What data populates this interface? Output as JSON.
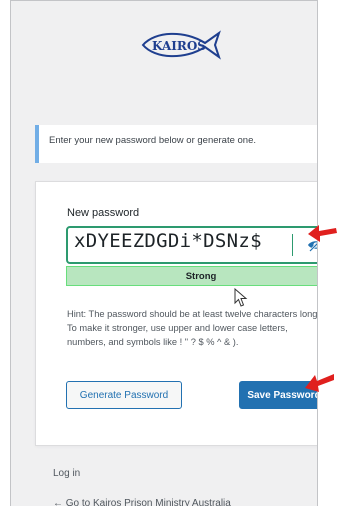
{
  "notice": {
    "text": "Enter your new password below or generate one."
  },
  "form": {
    "label": "New password",
    "password_value": "xDYEEZDGDi*DSNz$",
    "strength": "Strong",
    "hint": "Hint: The password should be at least twelve characters long. To make it stronger, use upper and lower case letters, numbers, and symbols like ! \" ? $ % ^ & ).",
    "generate_label": "Generate Password",
    "save_label": "Save Password"
  },
  "links": {
    "login": "Log in",
    "back": "← Go to Kairos Prison Ministry Australia"
  },
  "logo": {
    "text": "KAIROS"
  },
  "colors": {
    "accent": "#2271b1",
    "strong_bg": "#b8e6bf",
    "focus_border": "#2d9a6f",
    "annotation_arrow": "#e0201e",
    "notice_bar": "#72aee6"
  },
  "icons": {
    "password_toggle": "eye-slash-icon",
    "annotation": "red-arrow-icon",
    "pointer": "mouse-cursor-icon"
  }
}
